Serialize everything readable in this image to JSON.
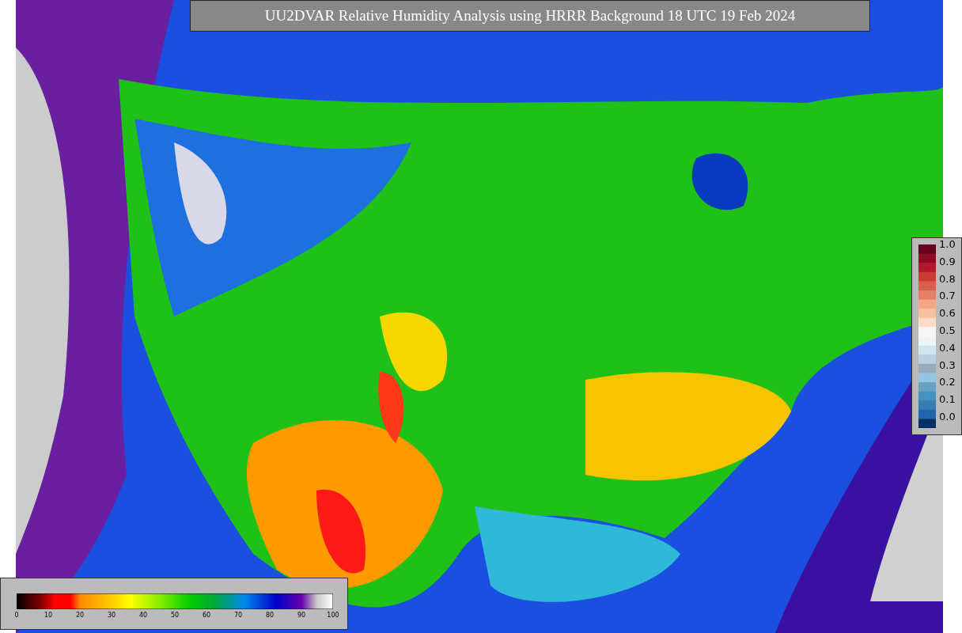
{
  "title": "UU2DVAR Relative Humidity Analysis using HRRR Background 18 UTC 19 Feb 2024",
  "right_colorbar": {
    "labels": [
      "1.0",
      "0.9",
      "0.8",
      "0.7",
      "0.6",
      "0.5",
      "0.4",
      "0.3",
      "0.2",
      "0.1",
      "0.0"
    ]
  },
  "bottom_colorbar": {
    "labels": [
      "0",
      "10",
      "20",
      "30",
      "40",
      "50",
      "60",
      "70",
      "80",
      "90",
      "100"
    ]
  }
}
